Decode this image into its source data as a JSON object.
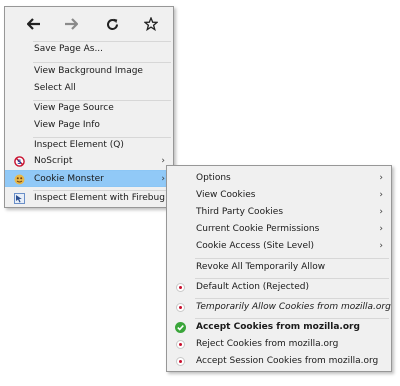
{
  "main_menu": {
    "items": [
      {
        "label": "Save Page As..."
      },
      {
        "label": "View Background Image"
      },
      {
        "label": "Select All"
      },
      {
        "label": "View Page Source"
      },
      {
        "label": "View Page Info"
      },
      {
        "label": "Inspect Element (Q)"
      },
      {
        "label": "NoScript",
        "arrow": "›"
      },
      {
        "label": "Cookie Monster",
        "arrow": "›"
      },
      {
        "label": "Inspect Element with Firebug"
      }
    ]
  },
  "sub_menu": {
    "items": [
      {
        "label": "Options",
        "arrow": "›"
      },
      {
        "label": "View Cookies",
        "arrow": "›"
      },
      {
        "label": "Third Party Cookies",
        "arrow": "›"
      },
      {
        "label": "Current Cookie Permissions",
        "arrow": "›"
      },
      {
        "label": "Cookie Access (Site Level)",
        "arrow": "›"
      },
      {
        "label": "Revoke All Temporarily Allow"
      },
      {
        "label": "Default Action (Rejected)"
      },
      {
        "label": "Temporarily Allow Cookies from mozilla.org"
      },
      {
        "label": "Accept Cookies from mozilla.org"
      },
      {
        "label": "Reject Cookies from mozilla.org"
      },
      {
        "label": "Accept Session Cookies from mozilla.org"
      }
    ]
  },
  "colors": {
    "highlight": "#91c9f7",
    "radio_dot": "#c8102e",
    "check": "#3aa53a"
  },
  "icons": {
    "toolbar": [
      "back-arrow-icon",
      "forward-arrow-icon",
      "reload-icon",
      "bookmark-star-icon"
    ]
  }
}
